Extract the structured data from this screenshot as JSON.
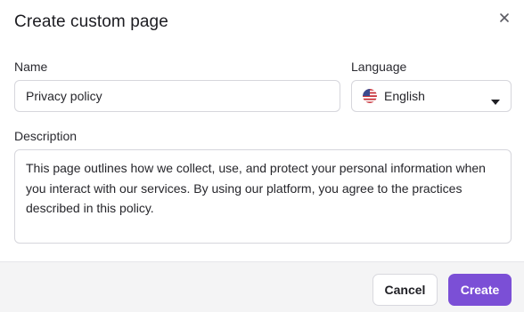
{
  "dialog": {
    "title": "Create custom page",
    "close_icon": "close-icon"
  },
  "form": {
    "name_label": "Name",
    "name_value": "Privacy policy",
    "language_label": "Language",
    "language_value": "English",
    "language_flag_icon": "us-flag-icon",
    "description_label": "Description",
    "description_value": "This page outlines how we collect, use, and protect your personal information when you interact with our services. By using our platform, you agree to the practices described in this policy."
  },
  "footer": {
    "cancel_label": "Cancel",
    "create_label": "Create"
  },
  "colors": {
    "primary": "#7b4fd6",
    "footer_bg": "#f4f4f5",
    "border": "#d6d6dc"
  }
}
